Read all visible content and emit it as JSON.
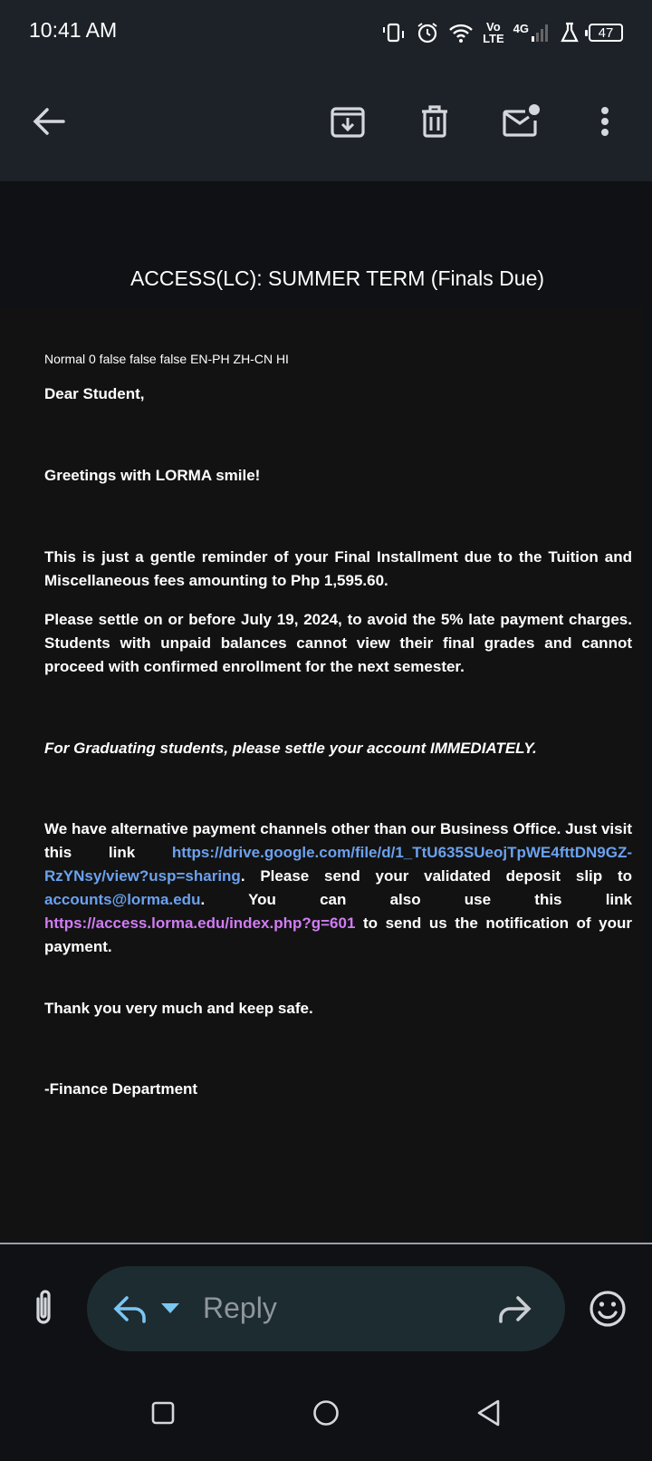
{
  "status_bar": {
    "time": "10:41 AM",
    "network_top": "Vo",
    "network_bottom": "LTE",
    "network_gen": "4G",
    "battery": "47"
  },
  "toolbar": {
    "back_icon": "arrow-back-icon",
    "archive_icon": "archive-icon",
    "delete_icon": "trash-icon",
    "mark_unread_icon": "mail-unread-icon",
    "more_icon": "more-vert-icon"
  },
  "email": {
    "subject": "ACCESS(LC): SUMMER TERM (Finals Due)",
    "meta_line": "Normal 0 false false false EN-PH ZH-CN HI",
    "greeting": "Dear Student,",
    "smile": "Greetings with LORMA smile!",
    "reminder": "This is just a gentle reminder of your Final Installment due to the Tuition and Miscellaneous fees amounting to Php 1,595.60.",
    "deadline": "Please settle on or before July 19, 2024, to avoid the 5% late payment charges. Students with unpaid balances cannot view their final grades and cannot proceed with confirmed enrollment for the next semester.",
    "graduating": "For Graduating students, please settle your account IMMEDIATELY.",
    "payment_p1": "We have alternative payment channels other than our Business Office. Just visit this link ",
    "drive_link": "https://drive.google.com/file/d/1_TtU635SUeojTpWE4fttDN9GZ-RzYNsy/view?usp=sharing",
    "payment_p2": ". Please send your validated deposit slip to ",
    "email_link": "accounts@lorma.edu",
    "payment_p3": ". You can also use this link ",
    "access_link": "https://access.lorma.edu/index.php?g=601",
    "payment_p4": " to send us the notification of your payment.",
    "thanks": "Thank you very much and keep safe.",
    "signature": "-Finance Department"
  },
  "reply_bar": {
    "placeholder": "Reply",
    "attach_icon": "paperclip-icon",
    "reply_icon": "reply-icon",
    "dropdown_icon": "caret-down-icon",
    "forward_icon": "forward-icon",
    "emoji_icon": "emoji-icon"
  },
  "colors": {
    "bar_bg": "#1d2128",
    "content_bg": "#121212",
    "link_blue": "#6ba1ef",
    "link_purple": "#d17cf5",
    "reply_icon_blue": "#7cc6f2"
  }
}
